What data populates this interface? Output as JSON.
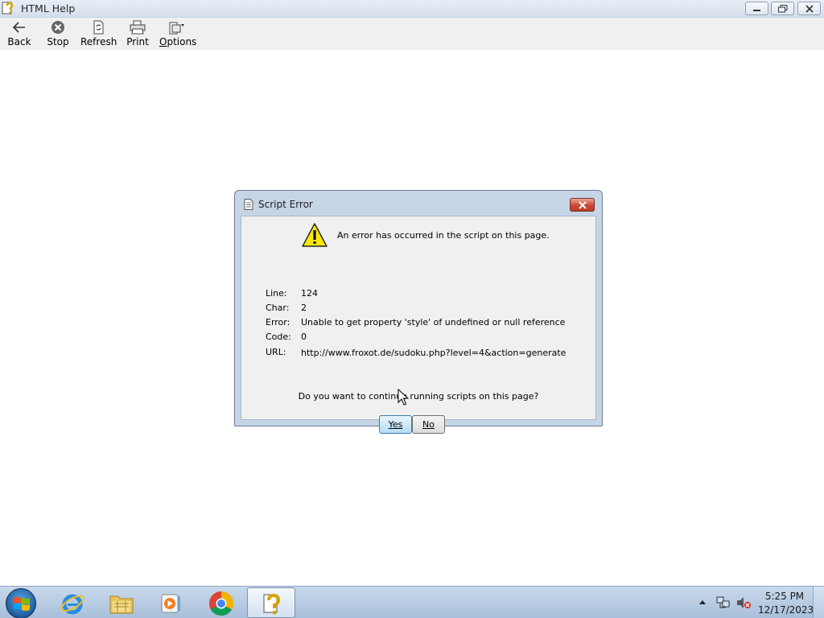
{
  "window": {
    "title": "HTML Help"
  },
  "toolbar": {
    "back": "Back",
    "stop": "Stop",
    "refresh": "Refresh",
    "print": "Print",
    "options": "Options"
  },
  "dialog": {
    "title": "Script Error",
    "message": "An error has occurred in the script on this page.",
    "rows": [
      {
        "label": "Line:",
        "value": "124"
      },
      {
        "label": "Char:",
        "value": "2"
      },
      {
        "label": "Error:",
        "value": "Unable to get property 'style' of undefined or null reference"
      },
      {
        "label": "Code:",
        "value": "0"
      },
      {
        "label": "URL:",
        "value": "http://www.froxot.de/sudoku.php?level=4&action=generate"
      }
    ],
    "question": "Do you want to continue running scripts on this page?",
    "yes_label": "Yes",
    "no_label": "No"
  },
  "taskbar": {
    "pinned": [
      "start-orb",
      "internet-explorer",
      "windows-explorer",
      "media-player",
      "google-chrome",
      "html-help"
    ],
    "clock_time": "5:25 PM",
    "clock_date": "12/17/2023"
  },
  "colors": {
    "dialog_frame": "#c6d5e6",
    "close_red": "#c84a33",
    "taskbar": "#b8cce4"
  }
}
